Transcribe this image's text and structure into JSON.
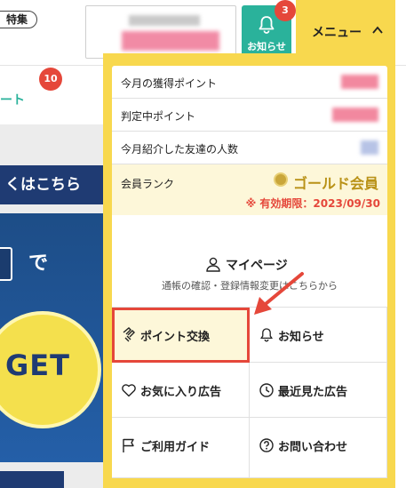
{
  "header": {
    "tag": "特集",
    "notification_label": "お知らせ",
    "notification_count": "3",
    "menu_label": "メニュー"
  },
  "sub_tab": {
    "label": "ート",
    "badge": "10"
  },
  "background": {
    "banner_text": "くはこちら",
    "promo_de": "で",
    "promo_get": "GET"
  },
  "stats": {
    "monthly_points_label": "今月の獲得ポイント",
    "pending_points_label": "判定中ポイント",
    "referrals_label": "今月紹介した友達の人数",
    "rank_label": "会員ランク",
    "rank_name": "ゴールド会員",
    "rank_expiry": "※ 有効期限：2023/09/30"
  },
  "nav": {
    "mypage_title": "マイページ",
    "mypage_sub": "通帳の確認・登録情報変更はこちらから",
    "items": [
      {
        "label": "ポイント交換",
        "icon": "exchange-icon"
      },
      {
        "label": "お知らせ",
        "icon": "bell-icon"
      },
      {
        "label": "お気に入り広告",
        "icon": "heart-icon"
      },
      {
        "label": "最近見た広告",
        "icon": "history-icon"
      },
      {
        "label": "ご利用ガイド",
        "icon": "flag-icon"
      },
      {
        "label": "お問い合わせ",
        "icon": "question-icon"
      }
    ]
  },
  "colors": {
    "accent_yellow": "#f8d84e",
    "teal": "#2ab29b",
    "badge_red": "#e5473a",
    "gold_text": "#b99217"
  }
}
